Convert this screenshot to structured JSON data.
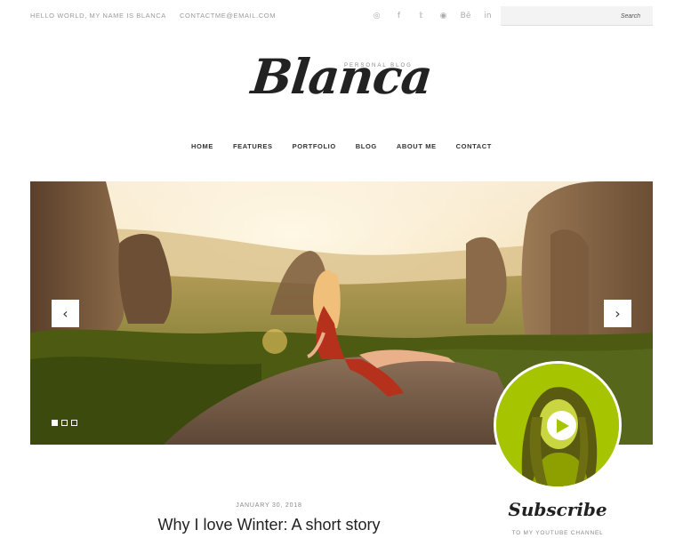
{
  "topbar": {
    "greeting": "HELLO WORLD, MY NAME IS BLANCA",
    "email": "CONTACTME@EMAIL.COM",
    "social_icons": [
      "instagram-icon",
      "facebook-icon",
      "twitter-icon",
      "dribbble-icon",
      "behance-icon",
      "linkedin-icon"
    ],
    "social_glyphs": [
      "◎",
      "f",
      "𝕥",
      "◉",
      "Bē",
      "in"
    ],
    "search_placeholder": "Search"
  },
  "logo": {
    "title": "Blanca",
    "subtitle": "PERSONAL BLOG"
  },
  "nav": {
    "items": [
      "HOME",
      "FEATURES",
      "PORTFOLIO",
      "BLOG",
      "ABOUT ME",
      "CONTACT"
    ]
  },
  "slider": {
    "prev_glyph": "‹",
    "next_glyph": "›",
    "slide_count": 3,
    "active_slide": 1
  },
  "post": {
    "date": "JANUARY 30, 2018",
    "title": "Why I love Winter: A short story"
  },
  "sidebar": {
    "subscribe_title": "Subscribe",
    "subscribe_subtitle": "TO MY YOUTUBE CHANNEL"
  },
  "colors": {
    "accent": "#a6c400",
    "text": "#222222",
    "muted": "#9a9a9a"
  }
}
